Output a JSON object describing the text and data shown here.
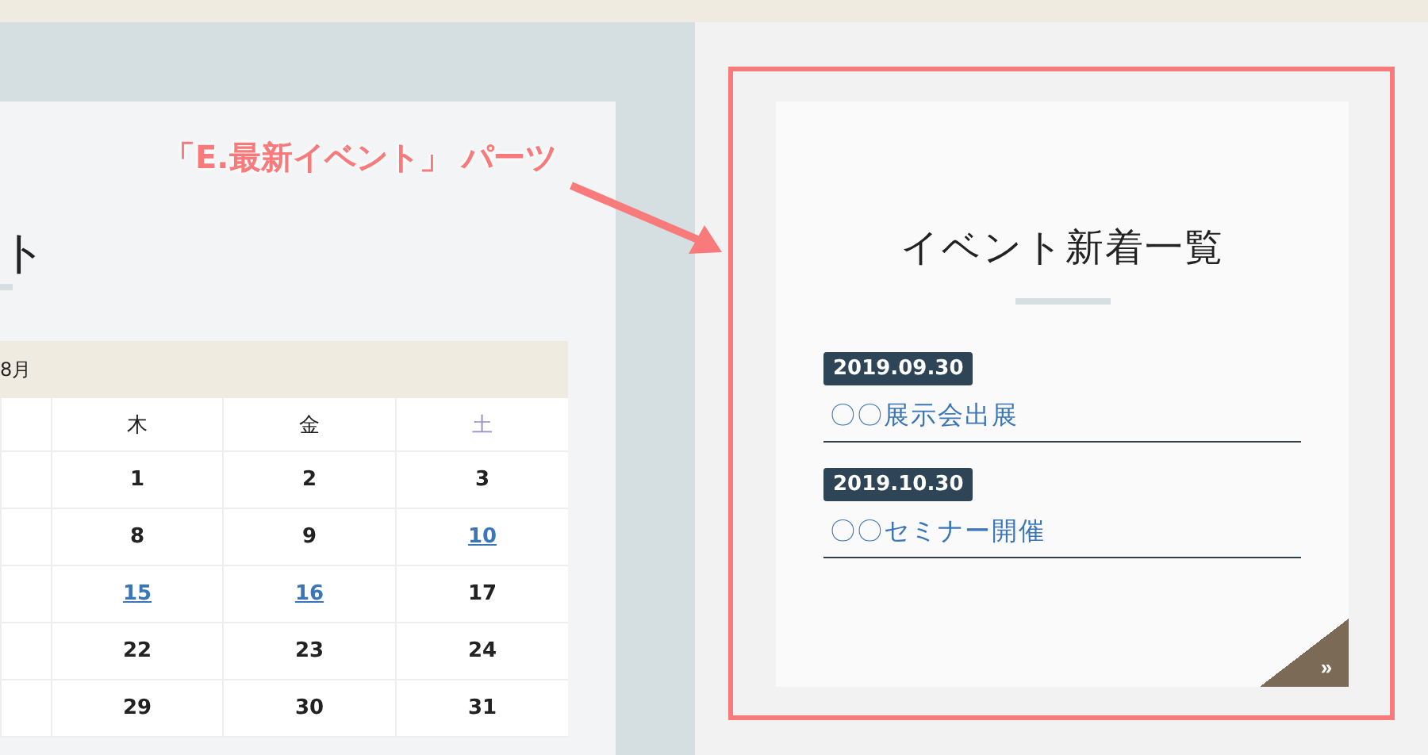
{
  "annotation": {
    "label": "「E.最新イベント」 パーツ"
  },
  "calendar_panel": {
    "title_fragment": "ト",
    "calendar": {
      "month": "8月",
      "weekdays": [
        {
          "label": "木",
          "kind": "weekday"
        },
        {
          "label": "金",
          "kind": "weekday"
        },
        {
          "label": "土",
          "kind": "saturday"
        }
      ],
      "weeks": [
        [
          {
            "label": "1",
            "linked": false
          },
          {
            "label": "2",
            "linked": false
          },
          {
            "label": "3",
            "linked": false
          }
        ],
        [
          {
            "label": "8",
            "linked": false
          },
          {
            "label": "9",
            "linked": false
          },
          {
            "label": "10",
            "linked": true
          }
        ],
        [
          {
            "label": "15",
            "linked": true
          },
          {
            "label": "16",
            "linked": true
          },
          {
            "label": "17",
            "linked": false
          }
        ],
        [
          {
            "label": "22",
            "linked": false
          },
          {
            "label": "23",
            "linked": false
          },
          {
            "label": "24",
            "linked": false
          }
        ],
        [
          {
            "label": "29",
            "linked": false
          },
          {
            "label": "30",
            "linked": false
          },
          {
            "label": "31",
            "linked": false
          }
        ]
      ]
    }
  },
  "events_panel": {
    "title": "イベント新着一覧",
    "events": [
      {
        "date": "2019.09.30",
        "title": "〇〇展示会出展"
      },
      {
        "date": "2019.10.30",
        "title": "〇〇セミナー開催"
      }
    ],
    "more_button": {
      "label": "»"
    }
  }
}
